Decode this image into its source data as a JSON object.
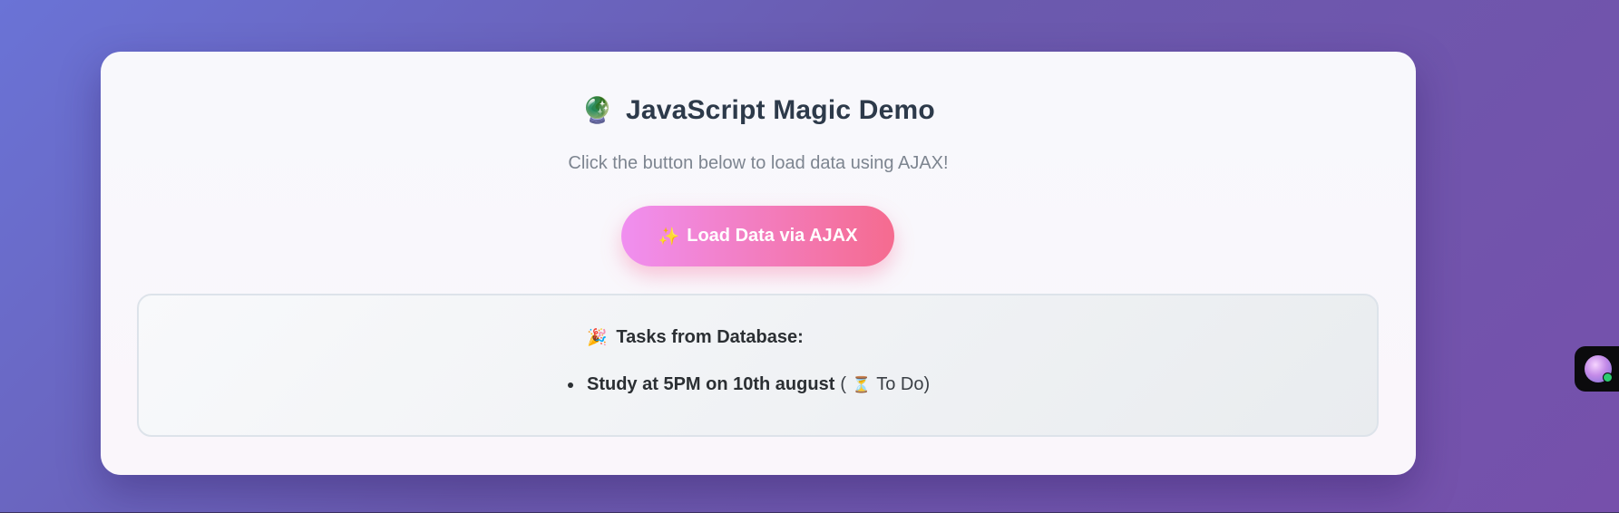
{
  "page": {
    "title_icon": "crystal-ball-icon",
    "title": "JavaScript Magic Demo",
    "subtitle": "Click the button below to load data using AJAX!"
  },
  "load_button": {
    "icon": "sparkles-icon",
    "label": "Load Data via AJAX",
    "gradient_start": "#f08ff0",
    "gradient_end": "#f56b8f"
  },
  "results": {
    "heading_icon": "party-popper-icon",
    "heading": "Tasks from Database:",
    "tasks": [
      {
        "title": "Study at 5PM on 10th august",
        "status_prefix": "(",
        "status_icon": "hourglass-icon",
        "status": "To Do)"
      }
    ]
  },
  "floating_widget": {
    "icon": "assistant-avatar-icon",
    "status_color": "#2ecc71"
  },
  "colors": {
    "background_start": "#6a73d6",
    "background_end": "#7650ab",
    "title": "#2d3a4a",
    "subtitle": "#7d8590"
  }
}
